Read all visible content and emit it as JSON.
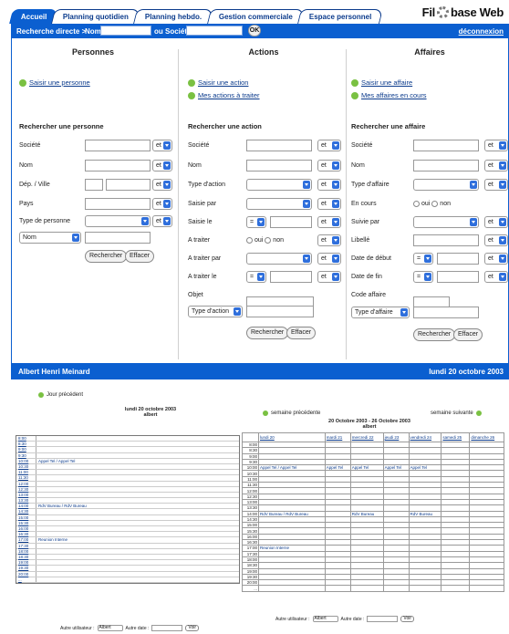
{
  "tabs": [
    "Accueil",
    "Planning quotidien",
    "Planning hebdo.",
    "Gestion commerciale",
    "Espace personnel"
  ],
  "logo": {
    "left": "Fil",
    "right": "base Web"
  },
  "search": {
    "label": "Recherche directe >",
    "nom": "Nom",
    "societe": "ou Société",
    "ok": "OK",
    "logout": "déconnexion"
  },
  "personnes": {
    "title": "Personnes",
    "link": "Saisir une personne",
    "search_title": "Rechercher une personne",
    "fields": [
      "Société",
      "Nom",
      "Dép. / Ville",
      "Pays",
      "Type de personne"
    ],
    "sort": "Nom",
    "et": "et"
  },
  "actions": {
    "title": "Actions",
    "link1": "Saisir une action",
    "link2": "Mes actions à traiter",
    "search_title": "Rechercher une action",
    "fields": [
      "Société",
      "Nom",
      "Type d'action",
      "Saisie par",
      "Saisie le",
      "A traiter",
      "A traiter par",
      "A traiter le",
      "Objet"
    ],
    "type": "Type d'action",
    "eq": "="
  },
  "affaires": {
    "title": "Affaires",
    "link1": "Saisir une affaire",
    "link2": "Mes affaires en cours",
    "search_title": "Rechercher une affaire",
    "fields": [
      "Société",
      "Nom",
      "Type d'affaire",
      "En cours",
      "Suivie par",
      "Libellé",
      "Date de début",
      "Date de fin",
      "Code affaire"
    ],
    "type": "Type d'affaire"
  },
  "buttons": {
    "search": "Rechercher",
    "clear": "Effacer",
    "oui": "oui",
    "non": "non"
  },
  "footer": {
    "user": "Albert Henri Meinard",
    "date": "lundi 20 octobre 2003"
  },
  "day": {
    "prev": "Jour précédent",
    "title": "lundi 20 octobre 2003",
    "user": "albert",
    "rows": [
      [
        "8:00",
        ""
      ],
      [
        "8:30",
        ""
      ],
      [
        "9:00",
        ""
      ],
      [
        "9:30",
        ""
      ],
      [
        "10:00",
        "Appel Tel / Appel Tel"
      ],
      [
        "10:30",
        ""
      ],
      [
        "11:00",
        ""
      ],
      [
        "11:30",
        ""
      ],
      [
        "12:00",
        ""
      ],
      [
        "12:30",
        ""
      ],
      [
        "13:00",
        ""
      ],
      [
        "13:30",
        ""
      ],
      [
        "14:00",
        "RdV Bureau / RdV Bureau"
      ],
      [
        "14:30",
        ""
      ],
      [
        "15:00",
        ""
      ],
      [
        "15:30",
        ""
      ],
      [
        "16:00",
        ""
      ],
      [
        "16:30",
        ""
      ],
      [
        "17:00",
        "Reunion Interne"
      ],
      [
        "17:30",
        ""
      ],
      [
        "18:00",
        ""
      ],
      [
        "18:30",
        ""
      ],
      [
        "19:00",
        ""
      ],
      [
        "19:30",
        ""
      ],
      [
        "20:00",
        ""
      ],
      [
        "...",
        ""
      ]
    ],
    "other_user": "Autre utilisateur :",
    "user_sel": "Albert",
    "other_date": "Autre date :",
    "voir": "Voir"
  },
  "week": {
    "prev": "semaine précédente",
    "next": "semaine suivante",
    "title": "20 Octobre 2003 - 26 Octobre 2003",
    "user": "albert",
    "days": [
      "lundi 20",
      "mardi 21",
      "mercredi 22",
      "jeudi 23",
      "vendredi 24",
      "samedi 25",
      "dimanche 26"
    ],
    "times": [
      "8:00",
      "8:30",
      "9:00",
      "9:30",
      "10:00",
      "10:30",
      "11:00",
      "11:30",
      "12:00",
      "12:30",
      "13:00",
      "13:30",
      "14:00",
      "14:30",
      "15:00",
      "15:30",
      "16:00",
      "16:30",
      "17:00",
      "17:30",
      "18:00",
      "18:30",
      "19:00",
      "19:30",
      "20:00",
      "..."
    ],
    "ev10": [
      "Appel Tel / Appel Tel",
      "Appel Tel",
      "Appel Tel",
      "Appel Tel",
      "Appel Tel"
    ],
    "ev14": [
      "RdV Bureau / RdV Bureau",
      "RdV Bureau",
      "RdV Bureau"
    ],
    "ev17": "Reunion Interne",
    "other_user": "Autre utilisateur :",
    "user_sel": "Albert",
    "other_date": "Autre date :",
    "voir": "Voir"
  }
}
